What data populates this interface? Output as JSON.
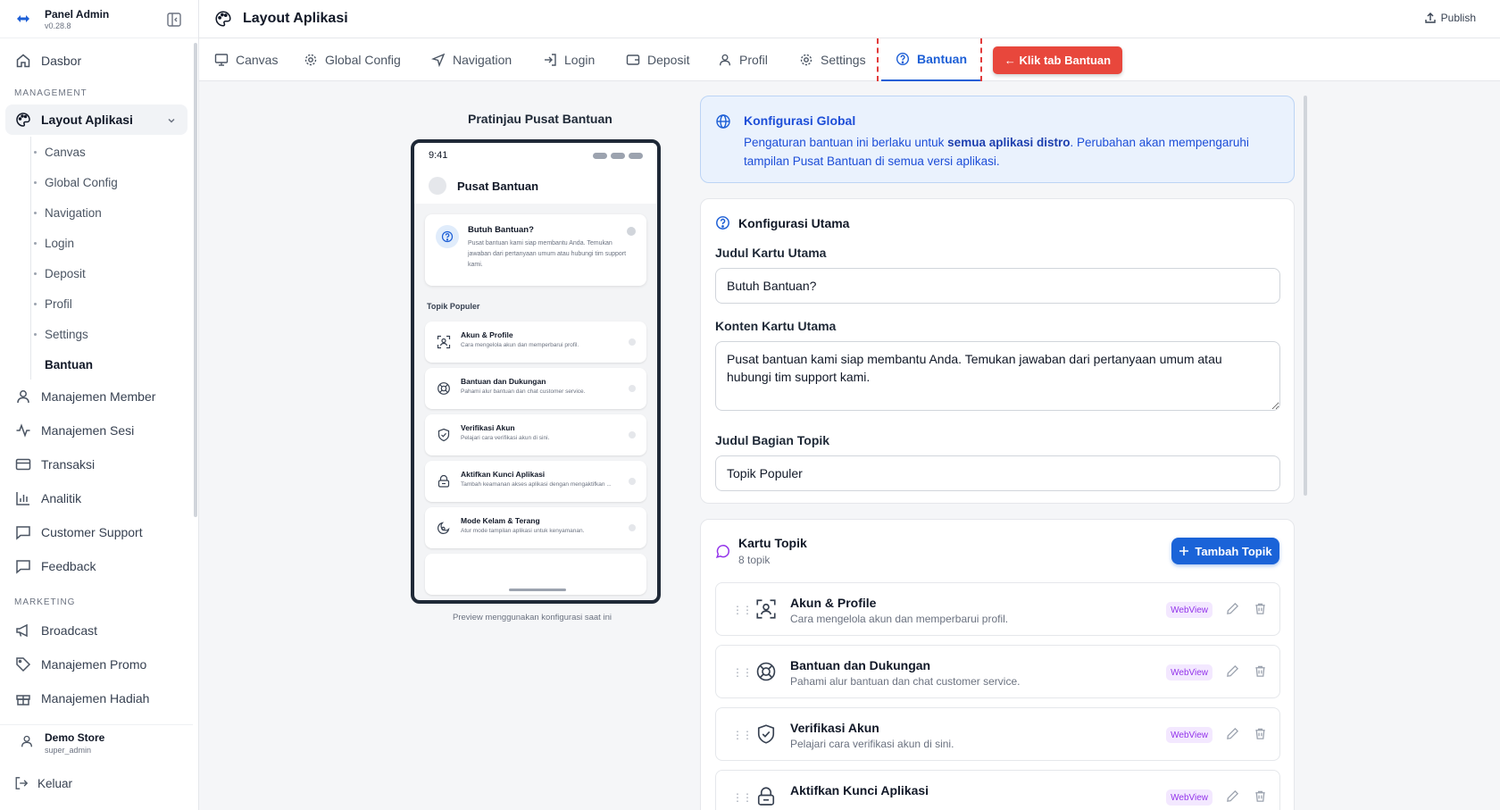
{
  "app": {
    "title": "Panel Admin",
    "version": "v0.28.8"
  },
  "sidebar": {
    "dashboard": "Dasbor",
    "management_label": "MANAGEMENT",
    "layout_label": "Layout Aplikasi",
    "sub_items": [
      {
        "label": "Canvas"
      },
      {
        "label": "Global Config"
      },
      {
        "label": "Navigation"
      },
      {
        "label": "Login"
      },
      {
        "label": "Deposit"
      },
      {
        "label": "Profil"
      },
      {
        "label": "Settings"
      },
      {
        "label": "Bantuan"
      }
    ],
    "items": [
      {
        "label": "Manajemen Member",
        "icon": "user-icon"
      },
      {
        "label": "Manajemen Sesi",
        "icon": "activity-icon"
      },
      {
        "label": "Transaksi",
        "icon": "credit-card-icon"
      },
      {
        "label": "Analitik",
        "icon": "bar-chart-icon"
      },
      {
        "label": "Customer Support",
        "icon": "message-icon"
      },
      {
        "label": "Feedback",
        "icon": "message-square-icon"
      }
    ],
    "marketing_label": "MARKETING",
    "marketing_items": [
      {
        "label": "Broadcast",
        "icon": "megaphone-icon"
      },
      {
        "label": "Manajemen Promo",
        "icon": "tag-icon"
      },
      {
        "label": "Manajemen Hadiah",
        "icon": "gift-icon"
      }
    ],
    "user": {
      "name": "Demo Store",
      "role": "super_admin"
    },
    "logout": "Keluar"
  },
  "header": {
    "title": "Layout Aplikasi",
    "publish": "Publish"
  },
  "tabs": [
    {
      "label": "Canvas"
    },
    {
      "label": "Global Config"
    },
    {
      "label": "Navigation"
    },
    {
      "label": "Login"
    },
    {
      "label": "Deposit"
    },
    {
      "label": "Profil"
    },
    {
      "label": "Settings"
    },
    {
      "label": "Bantuan"
    }
  ],
  "hint_button": "← Klik tab Bantuan",
  "preview": {
    "title": "Pratinjau Pusat Bantuan",
    "time": "9:41",
    "header": "Pusat Bantuan",
    "card_title": "Butuh Bantuan?",
    "card_body": "Pusat bantuan kami siap membantu Anda. Temukan jawaban dari pertanyaan umum atau hubungi tim support kami.",
    "topics_label": "Topik Populer",
    "topics": [
      {
        "title": "Akun & Profile",
        "sub": "Cara mengelola akun dan memperbarui profil."
      },
      {
        "title": "Bantuan dan Dukungan",
        "sub": "Pahami alur bantuan dan chat customer service."
      },
      {
        "title": "Verifikasi Akun",
        "sub": "Pelajari cara verifikasi akun di sini."
      },
      {
        "title": "Aktifkan Kunci Aplikasi",
        "sub": "Tambah keamanan akses aplikasi dengan mengaktifkan ..."
      },
      {
        "title": "Mode Kelam & Terang",
        "sub": "Atur mode tampilan aplikasi untuk kenyamanan."
      }
    ],
    "caption": "Preview menggunakan konfigurasi saat ini"
  },
  "global_config": {
    "title": "Konfigurasi Global",
    "text_before": "Pengaturan bantuan ini berlaku untuk ",
    "text_bold": "semua aplikasi distro",
    "text_after": ". Perubahan akan mempengaruhi tampilan Pusat Bantuan di semua versi aplikasi."
  },
  "main_config": {
    "title": "Konfigurasi Utama",
    "card_title_label": "Judul Kartu Utama",
    "card_title_value": "Butuh Bantuan?",
    "card_content_label": "Konten Kartu Utama",
    "card_content_value": "Pusat bantuan kami siap membantu Anda. Temukan jawaban dari pertanyaan umum atau hubungi tim support kami.",
    "section_title_label": "Judul Bagian Topik",
    "section_title_value": "Topik Populer"
  },
  "topic_cards": {
    "title": "Kartu Topik",
    "count": "8 topik",
    "add_button": "Tambah Topik",
    "badge": "WebView",
    "items": [
      {
        "title": "Akun & Profile",
        "sub": "Cara mengelola akun dan memperbarui profil."
      },
      {
        "title": "Bantuan dan Dukungan",
        "sub": "Pahami alur bantuan dan chat customer service."
      },
      {
        "title": "Verifikasi Akun",
        "sub": "Pelajari cara verifikasi akun di sini."
      },
      {
        "title": "Aktifkan Kunci Aplikasi",
        "sub": ""
      }
    ]
  },
  "colors": {
    "accent": "#1d5fd6",
    "hint": "#e8473c",
    "badge": "#9333ea"
  }
}
